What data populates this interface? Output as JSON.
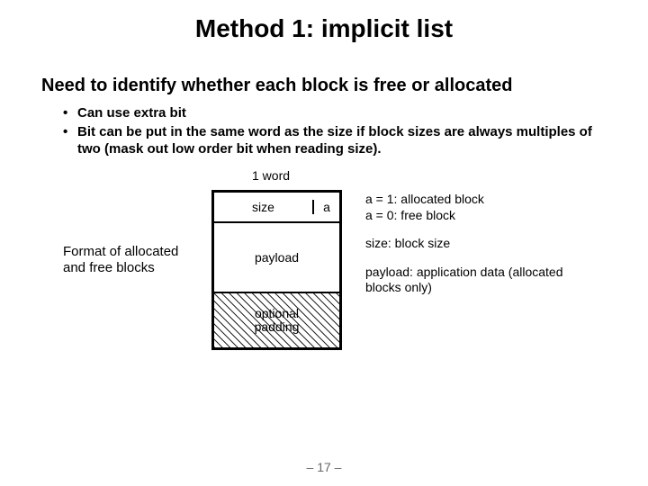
{
  "title": "Method 1: implicit list",
  "subheading": "Need to identify whether each block is free or allocated",
  "bullets": [
    "Can use extra bit",
    "Bit can be put in the same word as the size if block sizes are always multiples of two (mask out low order bit when reading size)."
  ],
  "diagram": {
    "word_label": "1 word",
    "header_size_label": "size",
    "header_flag_label": "a",
    "payload_label": "payload",
    "padding_line1": "optional",
    "padding_line2": "padding",
    "left_caption": "Format of allocated and free blocks"
  },
  "legend": {
    "flag_line1": "a = 1: allocated block",
    "flag_line2": "a = 0: free block",
    "size_line": "size: block size",
    "payload_line": "payload: application data (allocated blocks only)"
  },
  "footer": "– 17 –"
}
